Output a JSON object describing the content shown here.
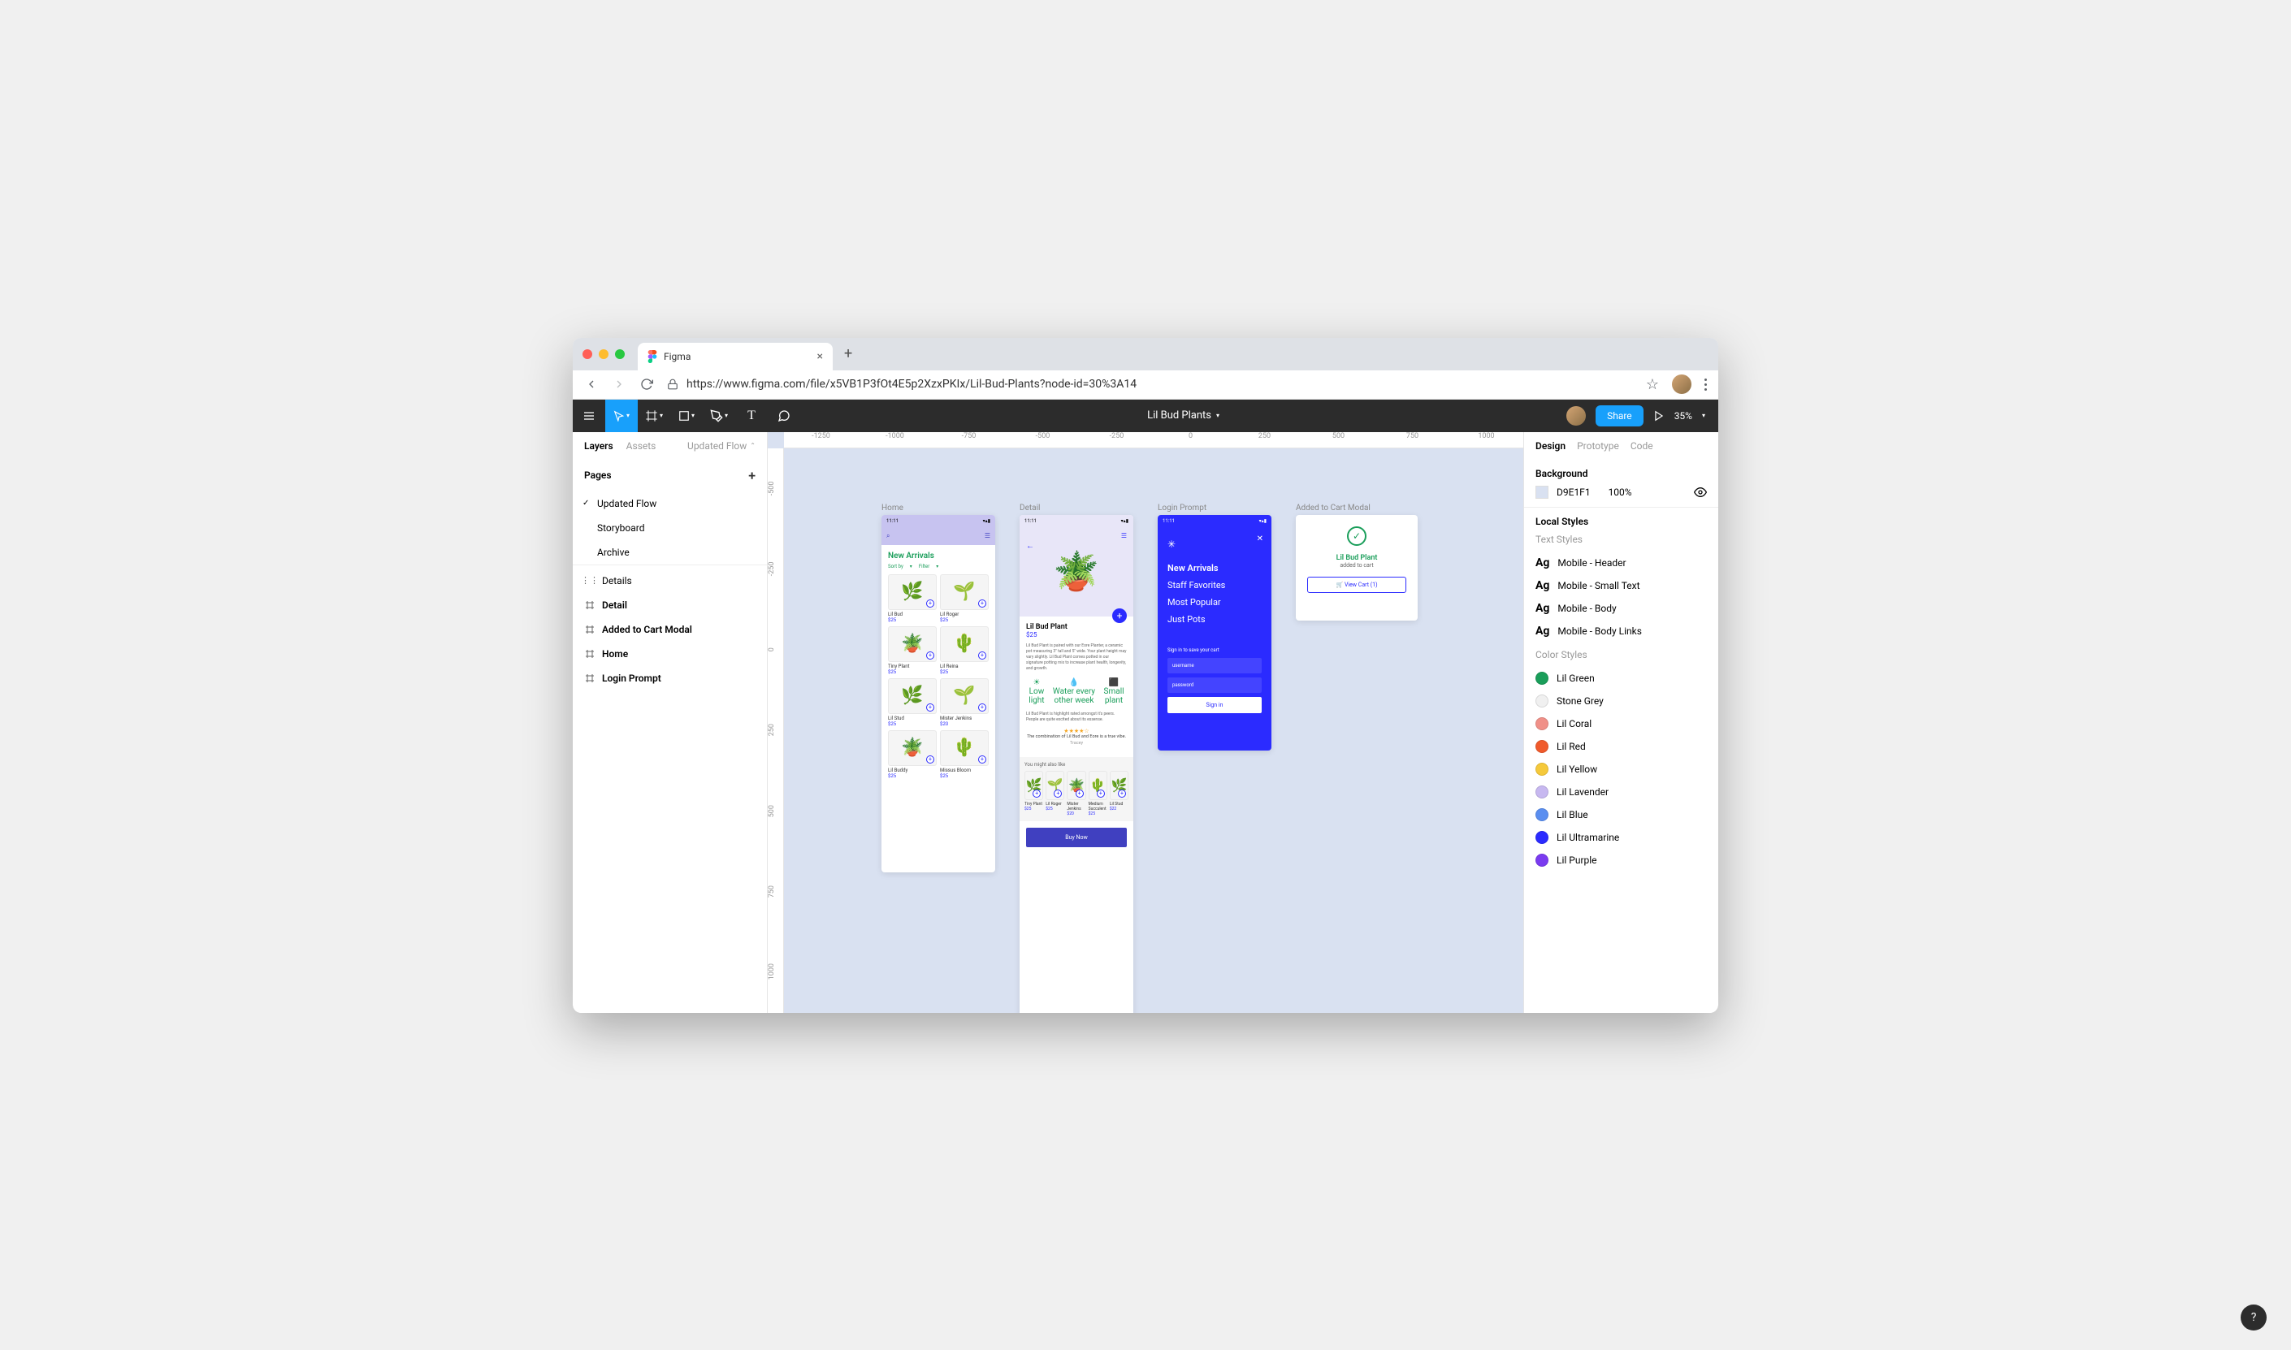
{
  "browser": {
    "tab_title": "Figma",
    "url": "https://www.figma.com/file/x5VB1P3fOt4E5p2XzxPKIx/Lil-Bud-Plants?node-id=30%3A14"
  },
  "toolbar": {
    "doc_title": "Lil Bud Plants",
    "share": "Share",
    "zoom": "35%"
  },
  "left_panel": {
    "tabs": {
      "layers": "Layers",
      "assets": "Assets",
      "page": "Updated Flow"
    },
    "pages_label": "Pages",
    "pages": [
      "Updated Flow",
      "Storyboard",
      "Archive"
    ],
    "layers": [
      {
        "icon": "dots",
        "name": "Details",
        "bold": false
      },
      {
        "icon": "frame",
        "name": "Detail",
        "bold": true
      },
      {
        "icon": "frame",
        "name": "Added to Cart Modal",
        "bold": true
      },
      {
        "icon": "frame",
        "name": "Home",
        "bold": true
      },
      {
        "icon": "frame",
        "name": "Login Prompt",
        "bold": true
      }
    ]
  },
  "ruler_h": [
    "-1250",
    "-1000",
    "-750",
    "-500",
    "-250",
    "0",
    "250",
    "500",
    "750",
    "1000"
  ],
  "ruler_v": [
    "-500",
    "-250",
    "0",
    "250",
    "500",
    "750",
    "1000"
  ],
  "frames": {
    "home": {
      "label": "Home",
      "time": "11:11",
      "section": "New Arrivals",
      "sort": "Sort by",
      "filter": "Filter",
      "products": [
        {
          "name": "Lil Bud",
          "price": "$25"
        },
        {
          "name": "Lil Roger",
          "price": "$25"
        },
        {
          "name": "Tiny Plant",
          "price": "$25"
        },
        {
          "name": "Lil Reina",
          "price": "$25"
        },
        {
          "name": "Lil Stud",
          "price": "$25"
        },
        {
          "name": "Mister Jenkins",
          "price": "$20"
        },
        {
          "name": "Lil Buddy",
          "price": "$25"
        },
        {
          "name": "Missus Bloom",
          "price": "$25"
        }
      ]
    },
    "detail": {
      "label": "Detail",
      "time": "11:11",
      "title": "Lil Bud Plant",
      "price": "$25",
      "desc": "Lil Bud Plant is paired with our Eore Planter, a ceramic pot measuring 3\" tall and 5\" wide. Your plant height may vary slightly. Lil Bud Plant comes potted in our signature potting mix to increase plant health, longevity, and growth.",
      "care": [
        "Low light",
        "Water every other week",
        "Small plant"
      ],
      "highlight": "Lil Bud Plant is highlight rated amongst it's peers. People are quite excited about its essense.",
      "review_quote": "The combination of Lil Bud and Eore is a true vibe.",
      "reviewer": "Tracey",
      "ymal_label": "You might also like",
      "ymal": [
        {
          "name": "Tiny Plant",
          "price": "$25"
        },
        {
          "name": "Lil Roger",
          "price": "$25"
        },
        {
          "name": "Mister Jenkins",
          "price": "$20"
        },
        {
          "name": "Medium Succulent",
          "price": "$25"
        },
        {
          "name": "Lil Stud",
          "price": "$22"
        }
      ],
      "buy": "Buy Now"
    },
    "login": {
      "label": "Login Prompt",
      "time": "11:11",
      "nav": [
        "New Arrivals",
        "Staff Favorites",
        "Most Popular",
        "Just Pots"
      ],
      "form_label": "Sign in to save your cart",
      "username": "username",
      "password": "password",
      "signin": "Sign in"
    },
    "modal": {
      "label": "Added to Cart Modal",
      "title": "Lil Bud Plant",
      "sub": "added to cart",
      "cta": "View Cart (1)"
    }
  },
  "right_panel": {
    "tabs": [
      "Design",
      "Prototype",
      "Code"
    ],
    "bg_label": "Background",
    "bg_hex": "D9E1F1",
    "bg_opacity": "100%",
    "local_styles": "Local Styles",
    "text_styles_label": "Text Styles",
    "text_styles": [
      "Mobile - Header",
      "Mobile - Small Text",
      "Mobile - Body",
      "Mobile - Body Links"
    ],
    "color_styles_label": "Color Styles",
    "color_styles": [
      {
        "name": "Lil Green",
        "hex": "#1a9e5a"
      },
      {
        "name": "Stone Grey",
        "hex": "#f0f0f0"
      },
      {
        "name": "Lil Coral",
        "hex": "#f09088"
      },
      {
        "name": "Lil Red",
        "hex": "#f05a2b"
      },
      {
        "name": "Lil Yellow",
        "hex": "#f5c93b"
      },
      {
        "name": "Lil Lavender",
        "hex": "#c7b8f0"
      },
      {
        "name": "Lil Blue",
        "hex": "#5a8ef0"
      },
      {
        "name": "Lil Ultramarine",
        "hex": "#2b2bff"
      },
      {
        "name": "Lil Purple",
        "hex": "#7a3bf0"
      }
    ]
  }
}
